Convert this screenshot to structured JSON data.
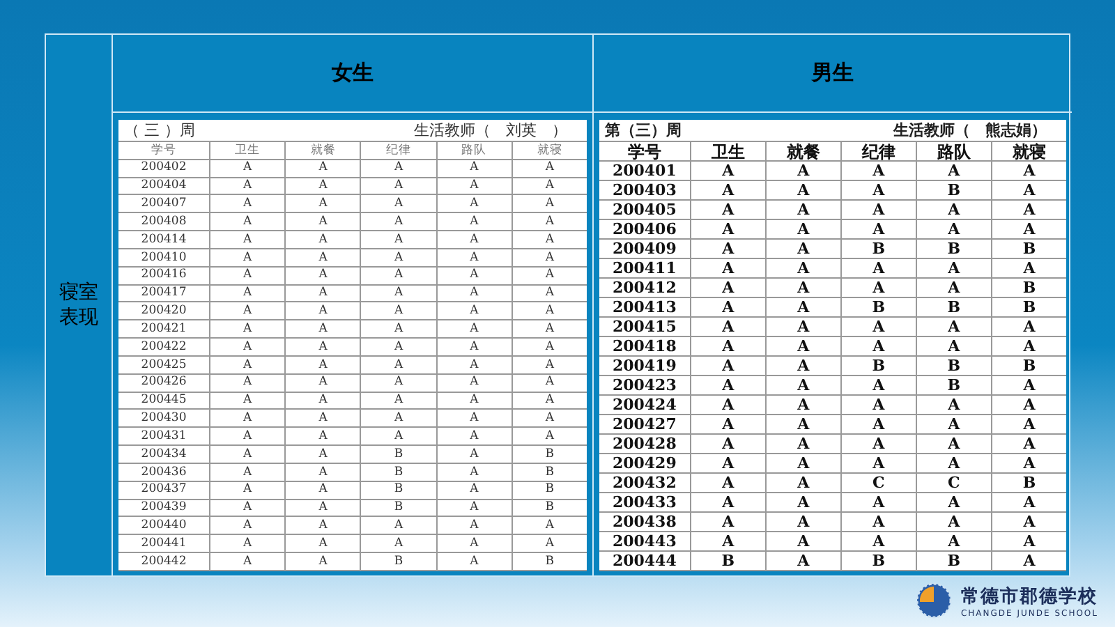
{
  "section_label": "寝室表现",
  "panels": [
    {
      "heading": "女生",
      "week": "（ 三 ）周",
      "teacher": "生活教师（　刘英　）",
      "kind": "plain",
      "columns": [
        "学号",
        "卫生",
        "就餐",
        "纪律",
        "路队",
        "就寝"
      ],
      "rows": [
        [
          "200402",
          "A",
          "A",
          "A",
          "A",
          "A"
        ],
        [
          "200404",
          "A",
          "A",
          "A",
          "A",
          "A"
        ],
        [
          "200407",
          "A",
          "A",
          "A",
          "A",
          "A"
        ],
        [
          "200408",
          "A",
          "A",
          "A",
          "A",
          "A"
        ],
        [
          "200414",
          "A",
          "A",
          "A",
          "A",
          "A"
        ],
        [
          "200410",
          "A",
          "A",
          "A",
          "A",
          "A"
        ],
        [
          "200416",
          "A",
          "A",
          "A",
          "A",
          "A"
        ],
        [
          "200417",
          "A",
          "A",
          "A",
          "A",
          "A"
        ],
        [
          "200420",
          "A",
          "A",
          "A",
          "A",
          "A"
        ],
        [
          "200421",
          "A",
          "A",
          "A",
          "A",
          "A"
        ],
        [
          "200422",
          "A",
          "A",
          "A",
          "A",
          "A"
        ],
        [
          "200425",
          "A",
          "A",
          "A",
          "A",
          "A"
        ],
        [
          "200426",
          "A",
          "A",
          "A",
          "A",
          "A"
        ],
        [
          "200445",
          "A",
          "A",
          "A",
          "A",
          "A"
        ],
        [
          "200430",
          "A",
          "A",
          "A",
          "A",
          "A"
        ],
        [
          "200431",
          "A",
          "A",
          "A",
          "A",
          "A"
        ],
        [
          "200434",
          "A",
          "A",
          "B",
          "A",
          "B"
        ],
        [
          "200436",
          "A",
          "A",
          "B",
          "A",
          "B"
        ],
        [
          "200437",
          "A",
          "A",
          "B",
          "A",
          "B"
        ],
        [
          "200439",
          "A",
          "A",
          "B",
          "A",
          "B"
        ],
        [
          "200440",
          "A",
          "A",
          "A",
          "A",
          "A"
        ],
        [
          "200441",
          "A",
          "A",
          "A",
          "A",
          "A"
        ],
        [
          "200442",
          "A",
          "A",
          "B",
          "A",
          "B"
        ]
      ]
    },
    {
      "heading": "男生",
      "week": "第（三）周",
      "teacher": "生活教师（　熊志娟）",
      "kind": "bold",
      "columns": [
        "学号",
        "卫生",
        "就餐",
        "纪律",
        "路队",
        "就寝"
      ],
      "rows": [
        [
          "200401",
          "A",
          "A",
          "A",
          "A",
          "A"
        ],
        [
          "200403",
          "A",
          "A",
          "A",
          "B",
          "A"
        ],
        [
          "200405",
          "A",
          "A",
          "A",
          "A",
          "A"
        ],
        [
          "200406",
          "A",
          "A",
          "A",
          "A",
          "A"
        ],
        [
          "200409",
          "A",
          "A",
          "B",
          "B",
          "B"
        ],
        [
          "200411",
          "A",
          "A",
          "A",
          "A",
          "A"
        ],
        [
          "200412",
          "A",
          "A",
          "A",
          "A",
          "B"
        ],
        [
          "200413",
          "A",
          "A",
          "B",
          "B",
          "B"
        ],
        [
          "200415",
          "A",
          "A",
          "A",
          "A",
          "A"
        ],
        [
          "200418",
          "A",
          "A",
          "A",
          "A",
          "A"
        ],
        [
          "200419",
          "A",
          "A",
          "B",
          "B",
          "B"
        ],
        [
          "200423",
          "A",
          "A",
          "A",
          "B",
          "A"
        ],
        [
          "200424",
          "A",
          "A",
          "A",
          "A",
          "A"
        ],
        [
          "200427",
          "A",
          "A",
          "A",
          "A",
          "A"
        ],
        [
          "200428",
          "A",
          "A",
          "A",
          "A",
          "A"
        ],
        [
          "200429",
          "A",
          "A",
          "A",
          "A",
          "A"
        ],
        [
          "200432",
          "A",
          "A",
          "C",
          "C",
          "B"
        ],
        [
          "200433",
          "A",
          "A",
          "A",
          "A",
          "A"
        ],
        [
          "200438",
          "A",
          "A",
          "A",
          "A",
          "A"
        ],
        [
          "200443",
          "A",
          "A",
          "A",
          "A",
          "A"
        ],
        [
          "200444",
          "B",
          "A",
          "B",
          "B",
          "A"
        ]
      ]
    }
  ],
  "school": {
    "name": "常德市郡德学校",
    "english": "CHANGDE JUNDE SCHOOL"
  }
}
